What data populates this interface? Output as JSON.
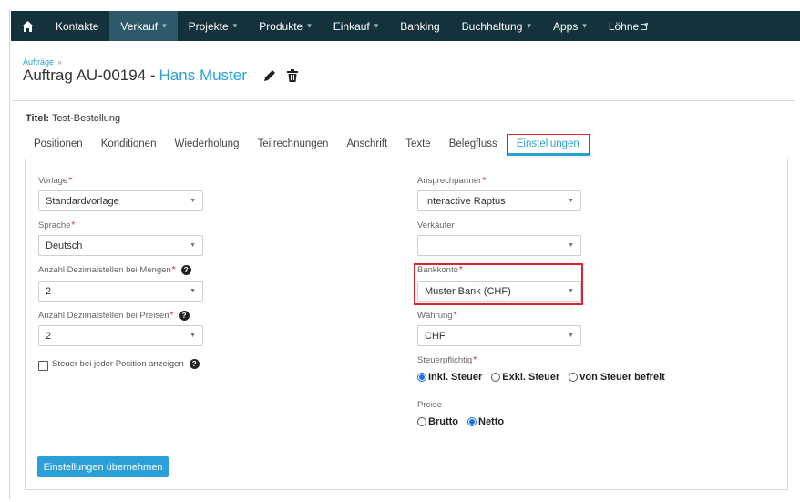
{
  "nav": {
    "items": [
      {
        "label": "Kontakte",
        "caret": false
      },
      {
        "label": "Verkauf",
        "caret": true,
        "active": true
      },
      {
        "label": "Projekte",
        "caret": true
      },
      {
        "label": "Produkte",
        "caret": true
      },
      {
        "label": "Einkauf",
        "caret": true
      },
      {
        "label": "Banking",
        "caret": false
      },
      {
        "label": "Buchhaltung",
        "caret": true
      },
      {
        "label": "Apps",
        "caret": true
      },
      {
        "label": "Löhne",
        "external": true
      }
    ],
    "caret_glyph": "▾",
    "bg": "#14323c"
  },
  "header": {
    "breadcrumb": "Aufträge",
    "breadcrumb_sep": "»",
    "title": "Auftrag AU-00194 - ",
    "customer": "Hans Muster",
    "edit_icon": "pencil-icon",
    "delete_icon": "trash-icon"
  },
  "order": {
    "titel_label": "Titel:",
    "titel_value": "Test-Bestellung"
  },
  "tabs": [
    "Positionen",
    "Konditionen",
    "Wiederholung",
    "Teilrechnungen",
    "Anschrift",
    "Texte",
    "Belegfluss",
    "Einstellungen"
  ],
  "form": {
    "required_mark": "*",
    "help_glyph": "?",
    "select_arrow": "▼",
    "vorlage": {
      "label": "Vorlage",
      "value": "Standardvorlage"
    },
    "sprache": {
      "label": "Sprache",
      "value": "Deutsch"
    },
    "dez_mengen": {
      "label": "Anzahl Dezimalstellen bei Mengen",
      "value": "2"
    },
    "dez_preisen": {
      "label": "Anzahl Dezimalstellen bei Preisen",
      "value": "2"
    },
    "steuer_check": {
      "label": "Steuer bei jeder Position anzeigen",
      "checked": false
    },
    "ansprechpartner": {
      "label": "Ansprechpartner",
      "value": "Interactive Raptus"
    },
    "verkaeufer": {
      "label": "Verkäufer",
      "value": ""
    },
    "bankkonto": {
      "label": "Bankkonto",
      "value": "Muster Bank (CHF)"
    },
    "waehrung": {
      "label": "Währung",
      "value": "CHF"
    },
    "steuerpflichtig": {
      "label": "Steuerpflichtig",
      "options": [
        {
          "label": "Inkl. Steuer",
          "selected": true
        },
        {
          "label": "Exkl. Steuer",
          "selected": false
        },
        {
          "label": "von Steuer befreit",
          "selected": false
        }
      ]
    },
    "preise": {
      "label": "Preise",
      "options": [
        {
          "label": "Brutto",
          "selected": false
        },
        {
          "label": "Netto",
          "selected": true
        }
      ]
    },
    "submit_label": "Einstellungen übernehmen"
  },
  "colors": {
    "accent": "#2a9fd8",
    "highlight": "#e0242f",
    "required": "#e0242f"
  }
}
